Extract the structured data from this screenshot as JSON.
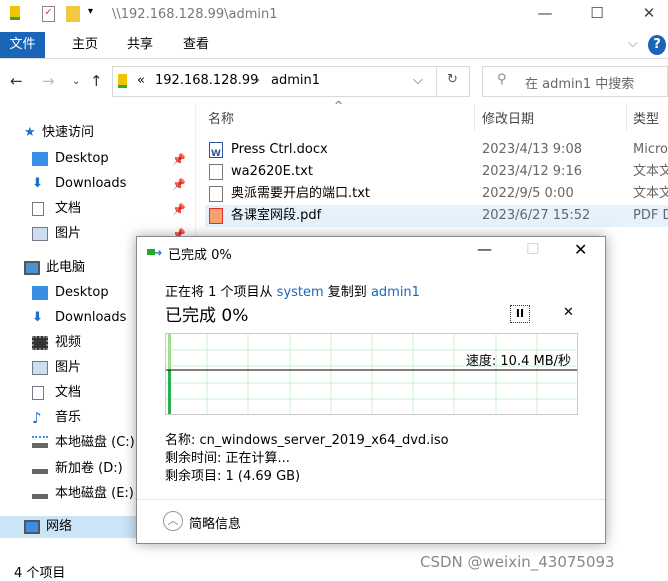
{
  "window": {
    "title": "\\\\192.168.128.99\\admin1",
    "minimize": "—",
    "maximize": "☐",
    "close": "✕"
  },
  "ribbon": {
    "tabs": [
      "文件",
      "主页",
      "共享",
      "查看"
    ],
    "expand": "⌵",
    "help": "?"
  },
  "address": {
    "prefix": "«",
    "segments": [
      "192.168.128.99",
      "admin1"
    ],
    "separator": "›",
    "dropdown": "⌵",
    "refresh": "↻"
  },
  "search": {
    "placeholder": "在 admin1 中搜索"
  },
  "columns": {
    "name": "名称",
    "date": "修改日期",
    "type": "类型",
    "sort_indicator": "^"
  },
  "sidebar": {
    "quick_access": "快速访问",
    "quick_items": [
      "Desktop",
      "Downloads",
      "文档",
      "图片"
    ],
    "this_pc": "此电脑",
    "pc_items": [
      "Desktop",
      "Downloads",
      "视频",
      "图片",
      "文档",
      "音乐",
      "本地磁盘 (C:)",
      "新加卷 (D:)",
      "本地磁盘 (E:)"
    ],
    "network": "网络"
  },
  "files": [
    {
      "name": "Press Ctrl.docx",
      "date": "2023/4/13 9:08",
      "type": "Micro",
      "icon": "word-icon"
    },
    {
      "name": "wa2620E.txt",
      "date": "2023/4/12 9:16",
      "type": "文本文",
      "icon": "text-file-icon"
    },
    {
      "name": "奥派需要开启的端口.txt",
      "date": "2022/9/5 0:00",
      "type": "文本文",
      "icon": "text-file-icon"
    },
    {
      "name": "各课室网段.pdf",
      "date": "2023/6/27 15:52",
      "type": "PDF D",
      "icon": "pdf-icon"
    }
  ],
  "status": {
    "count": "4 个项目"
  },
  "dialog": {
    "title": "已完成 0%",
    "copy_prefix": "正在将 1 个项目从 ",
    "source": "system",
    "copy_mid": " 复制到 ",
    "dest": "admin1",
    "progress_label": "已完成 0%",
    "progress_percent": 0,
    "pause": "II",
    "cancel": "✕",
    "speed": "速度: 10.4 MB/秒",
    "name": "名称: cn_windows_server_2019_x64_dvd.iso",
    "time_left": "剩余时间: 正在计算...",
    "items_left": "剩余项目: 1 (4.69 GB)",
    "details_toggle": "简略信息",
    "colors": {
      "graph_fill": "#22b14c",
      "grid": "#c8f0d0"
    }
  },
  "watermark": "CSDN @weixin_43075093"
}
